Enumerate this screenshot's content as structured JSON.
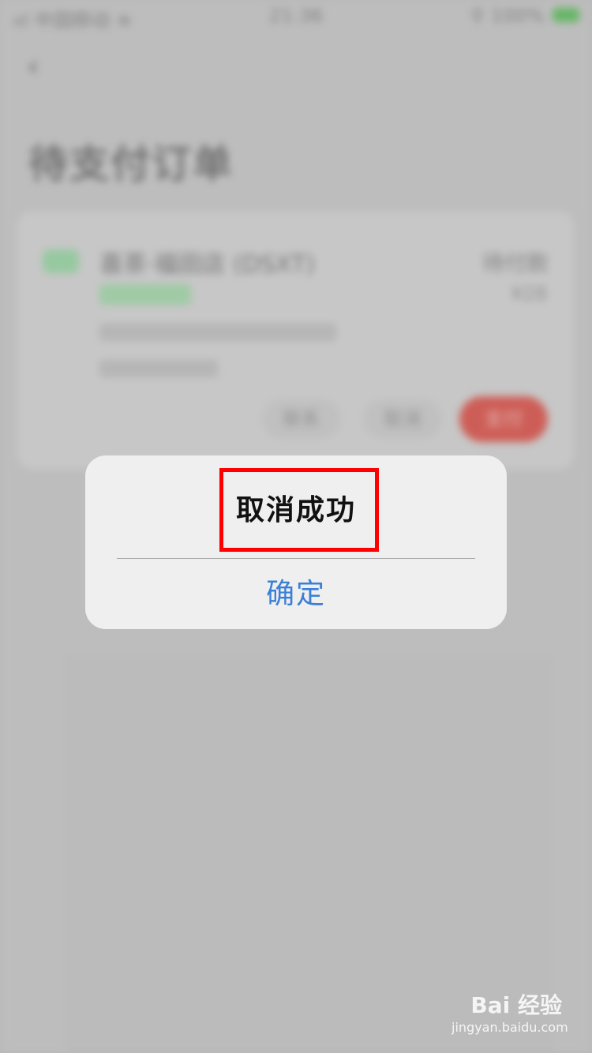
{
  "status_bar": {
    "left": "ııl 中国移动 ≋",
    "time": "21:36",
    "right": "⚲ 100%"
  },
  "page": {
    "title": "待支付订单"
  },
  "order": {
    "merchant": "喜茶·福田店 (DSXT)",
    "status": "待付款",
    "price": "¥28",
    "buttons": {
      "contact": "联系",
      "cancel": "取消",
      "pay": "支付"
    }
  },
  "alert": {
    "title": "取消成功",
    "confirm_label": "确定"
  },
  "watermark": {
    "logo": "Bai 经验",
    "site": "jingyan.baidu.com"
  },
  "colors": {
    "accent_blue": "#3b7fd6",
    "highlight_red": "#ff0000",
    "pay_button": "#d9645c"
  }
}
